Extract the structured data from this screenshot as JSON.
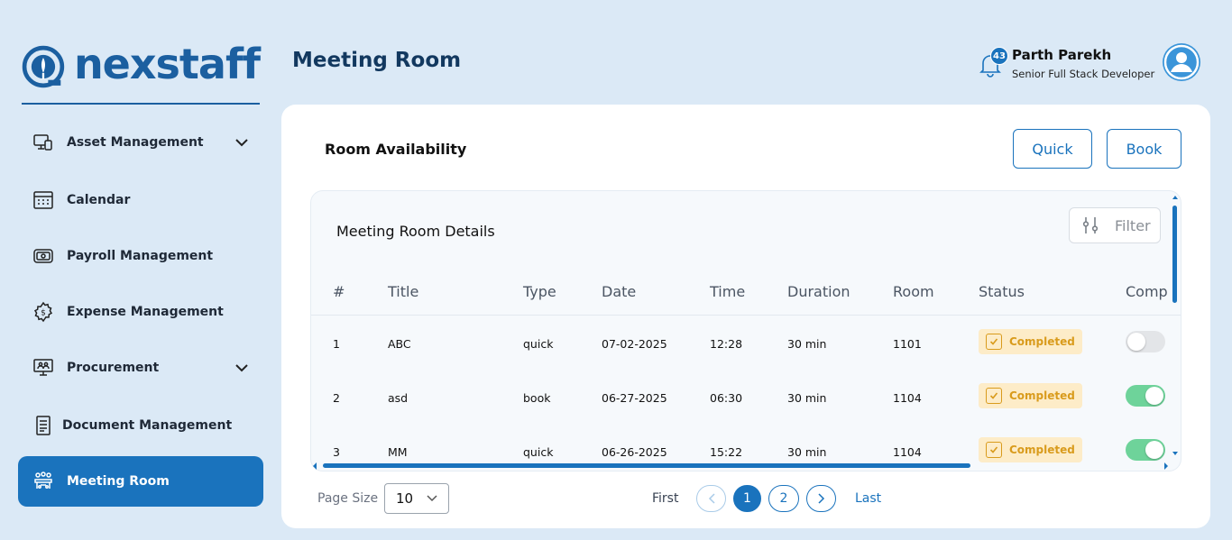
{
  "brand": {
    "name": "nexstaff",
    "color": "#1b5fa0"
  },
  "sidebar": {
    "items": [
      {
        "label": "Asset Management",
        "icon": "devices-icon",
        "has_submenu": true
      },
      {
        "label": "Calendar",
        "icon": "calendar-icon"
      },
      {
        "label": "Payroll Management",
        "icon": "cash-icon"
      },
      {
        "label": "Expense Management",
        "icon": "gear-dollar-icon"
      },
      {
        "label": "Procurement",
        "icon": "monitor-people-icon",
        "has_submenu": true
      },
      {
        "label": "Document Management",
        "icon": "document-icon"
      },
      {
        "label": "Meeting Room",
        "icon": "meeting-icon",
        "active": true
      }
    ]
  },
  "header": {
    "title": "Meeting Room",
    "notification_count": "43",
    "user_name": "Parth Parekh",
    "user_role": "Senior Full Stack Developer"
  },
  "card": {
    "title": "Room Availability",
    "quick_label": "Quick",
    "book_label": "Book"
  },
  "table": {
    "title": "Meeting Room Details",
    "filter_label": "Filter",
    "columns": [
      "#",
      "Title",
      "Type",
      "Date",
      "Time",
      "Duration",
      "Room",
      "Status",
      "Comp"
    ],
    "rows": [
      {
        "num": "1",
        "title": "ABC",
        "type": "quick",
        "date": "07-02-2025",
        "time": "12:28",
        "duration": "30 min",
        "room": "1101",
        "status": "Completed",
        "complete": false
      },
      {
        "num": "2",
        "title": "asd",
        "type": "book",
        "date": "06-27-2025",
        "time": "06:30",
        "duration": "30 min",
        "room": "1104",
        "status": "Completed",
        "complete": true
      },
      {
        "num": "3",
        "title": "MM",
        "type": "quick",
        "date": "06-26-2025",
        "time": "15:22",
        "duration": "30 min",
        "room": "1104",
        "status": "Completed",
        "complete": true
      }
    ]
  },
  "pagination": {
    "page_size_label": "Page Size",
    "page_size_value": "10",
    "first_label": "First",
    "pages": [
      "1",
      "2"
    ],
    "current_page": "1",
    "last_label": "Last"
  },
  "colors": {
    "background": "#dbe9f6",
    "accent": "#1a73bd",
    "status_bg": "#fdecc8",
    "status_text": "#d99b1c",
    "toggle_on": "#6ed39a"
  }
}
